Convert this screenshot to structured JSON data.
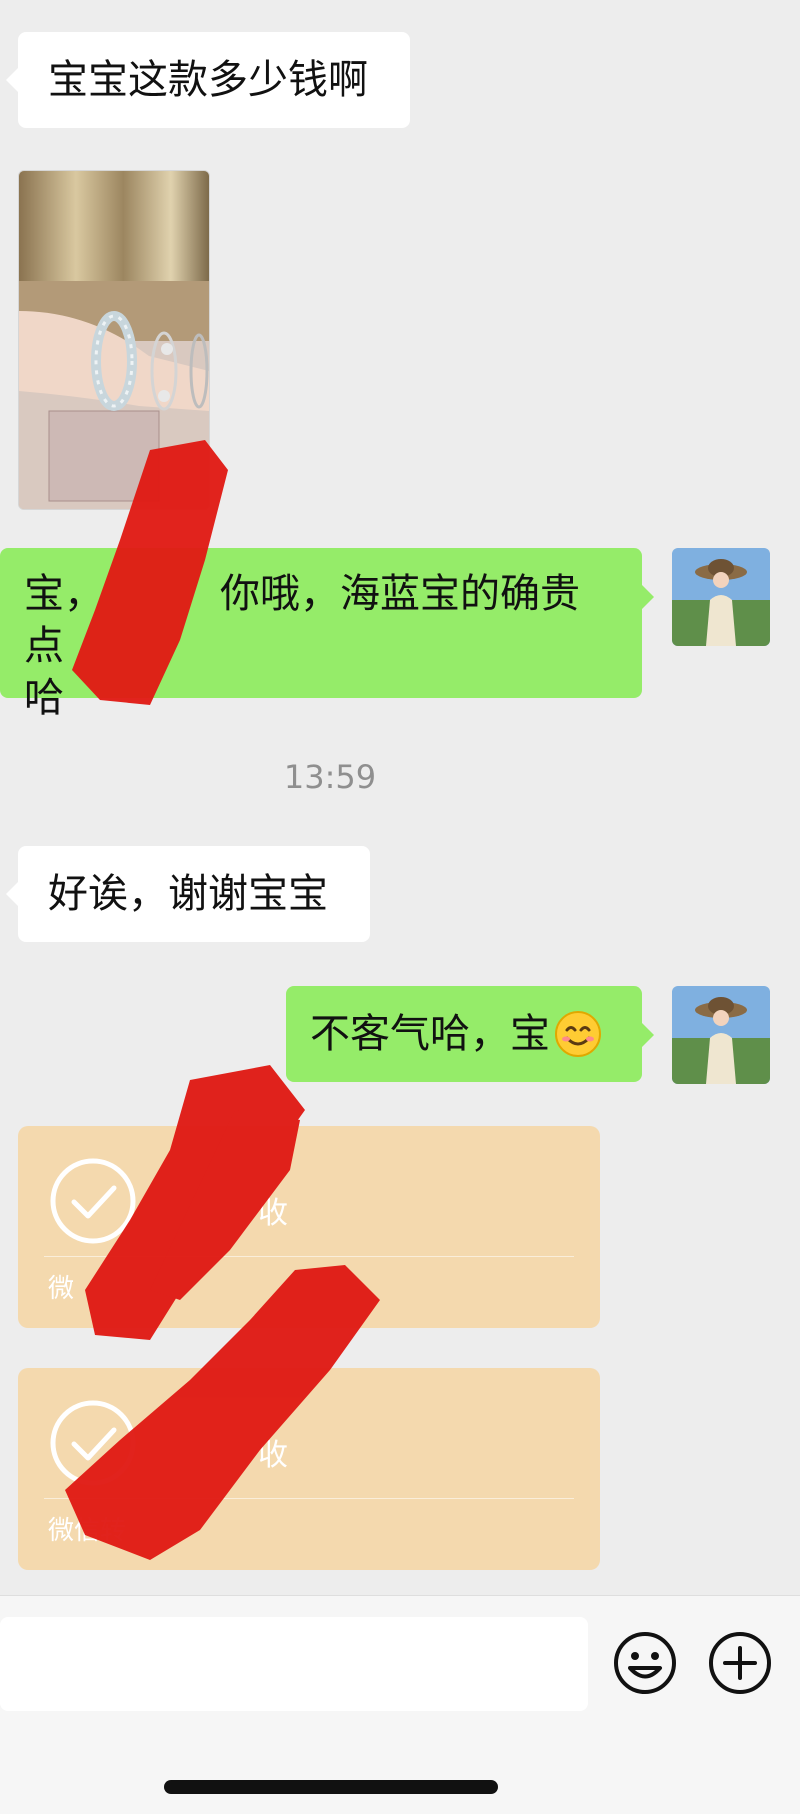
{
  "messages": {
    "incoming_1": "宝宝这款多少钱啊",
    "outgoing_1_line1": "宝，",
    "outgoing_1_line1b": "你哦，海蓝宝的确贵点",
    "outgoing_1_line2": "哈",
    "time": "13:59",
    "incoming_2": "好诶，谢谢宝宝",
    "outgoing_2": "不客气哈，宝"
  },
  "transfers": [
    {
      "status": "收",
      "footer": "微"
    },
    {
      "status": "收",
      "footer": "微信转"
    }
  ],
  "icons": {
    "emoji_button": "smiley-icon",
    "more_button": "plus-circle-icon",
    "transfer_check": "check-circle-icon",
    "avatar": "avatar-photo",
    "sticker": "smiling-face-icon"
  },
  "colors": {
    "background": "#ededed",
    "outgoing_bubble": "#95ec69",
    "incoming_bubble": "#ffffff",
    "transfer_card": "#f4d9ae",
    "redaction": "#e01a14"
  }
}
